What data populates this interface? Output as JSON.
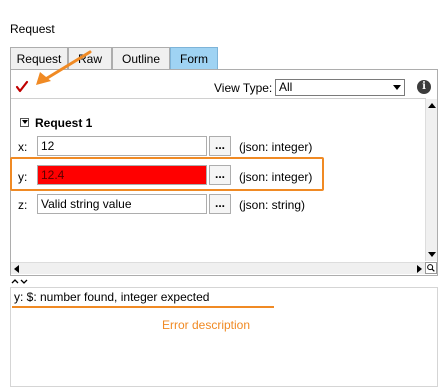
{
  "window": {
    "title": "Request"
  },
  "tabs": [
    {
      "label": "Request",
      "active": false
    },
    {
      "label": "Raw",
      "active": false
    },
    {
      "label": "Outline",
      "active": false
    },
    {
      "label": "Form",
      "active": true
    }
  ],
  "toolbar": {
    "validate_icon": "checkmark-icon",
    "view_type_label": "View Type:",
    "view_type_value": "All",
    "info_icon": "info-icon",
    "info_glyph": "i"
  },
  "form": {
    "heading": "Request 1",
    "rows": [
      {
        "label": "x:",
        "value": "12",
        "button": "...",
        "type": "(json: integer)",
        "error": false
      },
      {
        "label": "y:",
        "value": "12.4",
        "button": "...",
        "type": "(json: integer)",
        "error": true
      },
      {
        "label": "z:",
        "value": "Valid string value",
        "button": "...",
        "type": "(json: string)",
        "error": false
      }
    ]
  },
  "error_panel": {
    "message": "y: $: number found, integer expected",
    "annotation": "Error description"
  },
  "colors": {
    "accent": "#f08a24",
    "error_field": "#ff0000",
    "active_tab": "#9fd3f3"
  }
}
